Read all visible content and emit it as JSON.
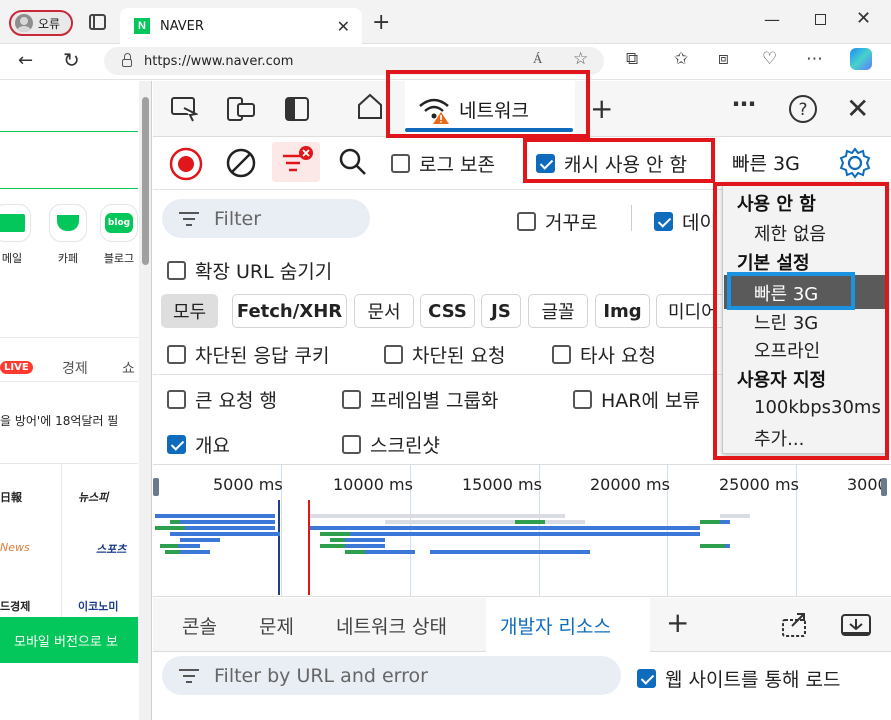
{
  "browser": {
    "profile_label": "오류",
    "tab_title": "NAVER",
    "favicon_letter": "N",
    "url": "https://www.naver.com",
    "read_aloud_label": "Á"
  },
  "page": {
    "services": [
      {
        "label": "메일",
        "color": "#03c75a",
        "icon": "mail-icon"
      },
      {
        "label": "카페",
        "color": "#03c75a",
        "icon": "cafe-icon"
      },
      {
        "label": "블로그",
        "color": "#03c75a",
        "icon": "blog-icon",
        "badge": "blog"
      }
    ],
    "live_badge": "LIVE",
    "news_econ": "경제",
    "news_show": "쇼",
    "headline": "을 방어'에 18억달러 필",
    "press": [
      "日報",
      "뉴스피",
      "News",
      "스포츠",
      "드경제",
      "이코노미"
    ],
    "mobile_button": "모바일 버전으로 보"
  },
  "devtools": {
    "network_tab": "네트워크",
    "toolbar": {
      "preserve_log": "로그 보존",
      "disable_cache": "캐시 사용 안 함",
      "throttle_value": "빠른 3G"
    },
    "filter_placeholder": "Filter",
    "invert": "거꾸로",
    "data_url_partial": "데이",
    "hide_ext_urls": "확장 URL 숨기기",
    "types": [
      "모두",
      "Fetch/XHR",
      "문서",
      "CSS",
      "JS",
      "글꼴",
      "Img",
      "미디어"
    ],
    "blocked_cookies": "차단된 응답 쿠키",
    "blocked_requests": "차단된 요청",
    "third_party": "타사 요청",
    "large_rows": "큰 요청 행",
    "group_by_frame": "프레임별 그룹화",
    "har_partial": "HAR에 보류",
    "overview": "개요",
    "screenshots": "스크린샷",
    "timeline_ticks": [
      "5000 ms",
      "10000 ms",
      "15000 ms",
      "20000 ms",
      "25000 ms",
      "3000"
    ],
    "drawer_tabs": [
      "콘솔",
      "문제",
      "네트워크 상태",
      "개발자 리소스"
    ],
    "drawer_filter_placeholder": "Filter by URL and error",
    "load_via_site": "웹 사이트를 통해 로드"
  },
  "throttle_menu": {
    "header_disabled": "사용 안 함",
    "no_throttle": "제한 없음",
    "header_presets": "기본 설정",
    "fast3g": "빠른 3G",
    "slow3g": "느린 3G",
    "offline": "오프라인",
    "header_custom": "사용자 지정",
    "custom1": "100kbps30ms",
    "add": "추가..."
  }
}
